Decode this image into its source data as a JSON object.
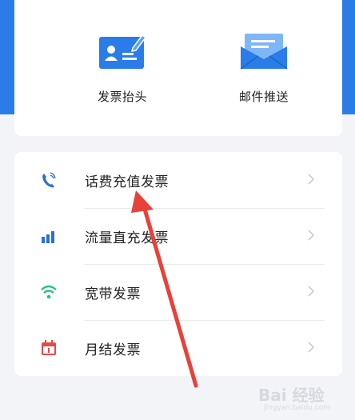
{
  "shortcuts": [
    {
      "label": "发票抬头",
      "icon": "invoice-title-card-icon"
    },
    {
      "label": "邮件推送",
      "icon": "envelope-icon"
    }
  ],
  "invoice_list": [
    {
      "label": "话费充值发票",
      "icon": "phone-icon",
      "color": "#2a6fd6"
    },
    {
      "label": "流量直充发票",
      "icon": "signal-bars-icon",
      "color": "#2a6fd6"
    },
    {
      "label": "宽带发票",
      "icon": "wifi-icon",
      "color": "#27c381"
    },
    {
      "label": "月结发票",
      "icon": "calendar-icon",
      "color": "#e24a4a"
    }
  ],
  "colors": {
    "brand_blue": "#2a7de8",
    "annotation_arrow": "#e8413a",
    "chevron": "#c6c8cd"
  },
  "watermark": {
    "text": "Bai 经验",
    "sub": "jingyan.baidu.com"
  }
}
